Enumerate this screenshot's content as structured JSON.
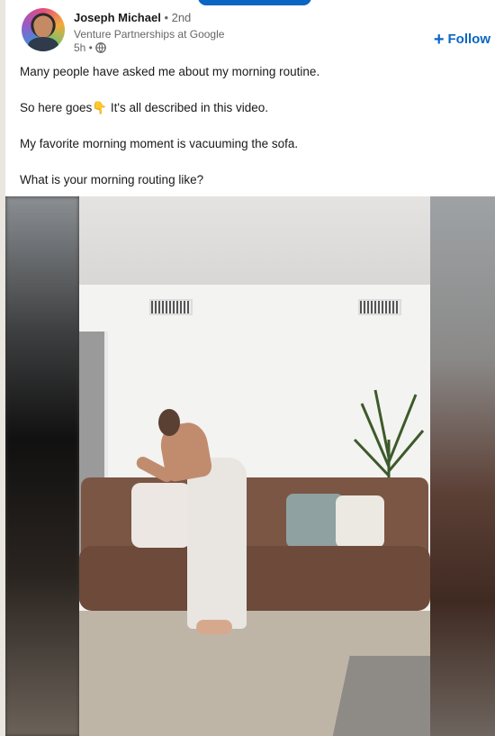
{
  "post": {
    "author": {
      "name": "Joseph Michael",
      "degree": "• 2nd",
      "headline": "Venture Partnerships at Google",
      "time": "5h •",
      "visibility_icon": "globe-icon"
    },
    "follow_label": "Follow",
    "follow_icon": "plus-icon",
    "text": {
      "line1": "Many people have asked me about my morning routine.",
      "line2": "So here goes👇 It's all described in this video.",
      "line3": "My favorite morning moment is vacuuming the sofa.",
      "line4": "What is your morning routing like?"
    }
  },
  "colors": {
    "accent": "#0a66c2",
    "text_primary": "#191919",
    "text_secondary": "#666666"
  }
}
